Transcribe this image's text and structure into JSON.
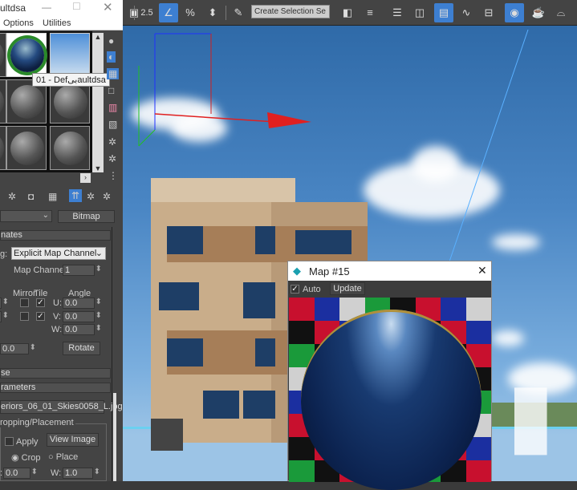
{
  "material_editor": {
    "title": "ultdsa",
    "menu": [
      "Options",
      "Utilities"
    ],
    "tooltip": "01 - Defبیaultdsa",
    "map_type_button": "Bitmap",
    "rollout_coordinates": "nates",
    "mapping_label": "g:",
    "mapping_value": "Explicit Map Channel",
    "map_channel_label": "Map Channel:",
    "map_channel_value": "1",
    "mirror_label": "Mirror",
    "tile_label": "Tile",
    "angle_label": "Angle",
    "u_label": "U:",
    "u_value": "0.0",
    "v_label": "V:",
    "v_value": "0.0",
    "w_label": "W:",
    "w_value": "0.0",
    "blur_value": "0.0",
    "rotate_button": "Rotate",
    "rollout_noise": "se",
    "rollout_params": "rameters",
    "bitmap_file": "eriors_06_01_Skies0058_L.jpg",
    "crop_group": "ropping/Placement",
    "apply_label": "Apply",
    "view_image_button": "View Image",
    "crop_label": "Crop",
    "place_label": "Place",
    "u_crop_label": ":",
    "u_crop_value": "0.0",
    "w_crop_label": "W:",
    "w_crop_value": "1.0"
  },
  "toolbar": {
    "snap_value": "2.5",
    "selection_set_placeholder": "Create Selection Se"
  },
  "map_window": {
    "title": "Map #15",
    "auto_label": "Auto",
    "update_button": "Update"
  }
}
